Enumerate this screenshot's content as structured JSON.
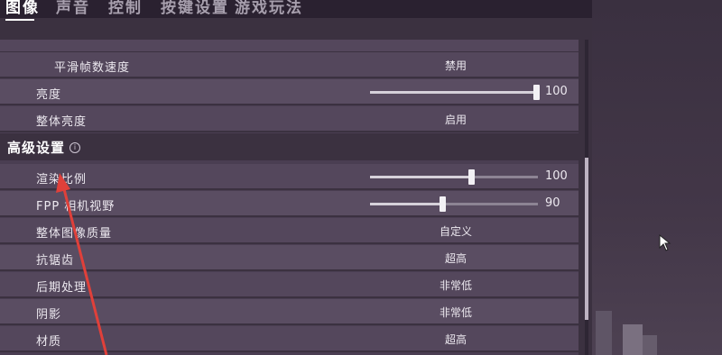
{
  "tabs": [
    {
      "label": "图像",
      "active": true
    },
    {
      "label": "声音"
    },
    {
      "label": "控制"
    },
    {
      "label": "按键设置"
    },
    {
      "label": "游戏玩法"
    }
  ],
  "rows_top": [
    {
      "label": "平滑帧数速度",
      "value": "禁用"
    },
    {
      "label": "亮度",
      "slider_value": "100",
      "slider_fraction": 1.0
    },
    {
      "label": "整体亮度",
      "value": "启用"
    }
  ],
  "advanced_section": {
    "title": "高级设置",
    "info_icon": "info-icon"
  },
  "rows_advanced": [
    {
      "label": "渲染比例",
      "slider_value": "100",
      "slider_fraction": 0.6
    },
    {
      "label": "FPP 相机视野",
      "slider_value": "90",
      "slider_fraction": 0.43
    },
    {
      "label": "整体图像质量",
      "value": "自定义"
    },
    {
      "label": "抗锯齿",
      "value": "超高"
    },
    {
      "label": "后期处理",
      "value": "非常低"
    },
    {
      "label": "阴影",
      "value": "非常低"
    },
    {
      "label": "材质",
      "value": "超高"
    }
  ],
  "colors": {
    "accent_arrow": "#e0403a",
    "panel": "#54475c"
  }
}
